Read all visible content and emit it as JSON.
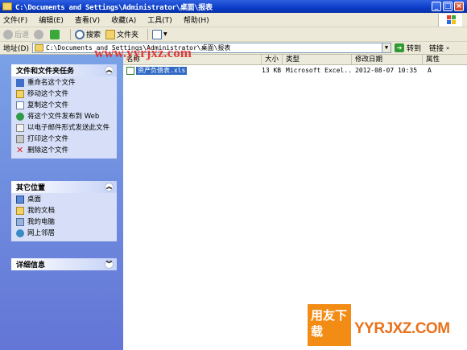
{
  "window": {
    "title": "C:\\Documents and Settings\\Administrator\\桌面\\报表",
    "min_label": "_",
    "max_label": "□",
    "close_label": "×"
  },
  "menu": [
    "文件(F)",
    "编辑(E)",
    "查看(V)",
    "收藏(A)",
    "工具(T)",
    "帮助(H)"
  ],
  "toolbar": {
    "back_label": "后退",
    "forward_label": "",
    "search_label": "搜索",
    "folders_label": "文件夹"
  },
  "address": {
    "label": "地址(D)",
    "value": "C:\\Documents and Settings\\Administrator\\桌面\\报表",
    "go_label": "转到",
    "links_label": "链接"
  },
  "panels": {
    "tasks": {
      "title": "文件和文件夹任务",
      "items": [
        "重命名这个文件",
        "移动这个文件",
        "复制这个文件",
        "将这个文件发布到 Web",
        "以电子邮件形式发送此文件",
        "打印这个文件",
        "删除这个文件"
      ]
    },
    "places": {
      "title": "其它位置",
      "items": [
        "桌面",
        "我的文档",
        "我的电脑",
        "网上邻居"
      ]
    },
    "details": {
      "title": "详细信息"
    }
  },
  "columns": [
    "名称",
    "大小",
    "类型",
    "修改日期",
    "属性"
  ],
  "files": [
    {
      "name": "资产负债表.xls",
      "size": "13 KB",
      "type": "Microsoft Excel...",
      "modified": "2012-08-07 10:35",
      "attr": "A"
    }
  ],
  "watermarks": {
    "site_top": "www.yyrjxz.com",
    "badge": "用友下载",
    "site_bottom": "YYRJXZ.COM"
  },
  "colors": {
    "titlebar": "#0a3cc8",
    "taskpane": "#7aa1e6",
    "selection": "#316ac5",
    "watermark_red": "#e02020",
    "watermark_orange": "#f28c14"
  }
}
